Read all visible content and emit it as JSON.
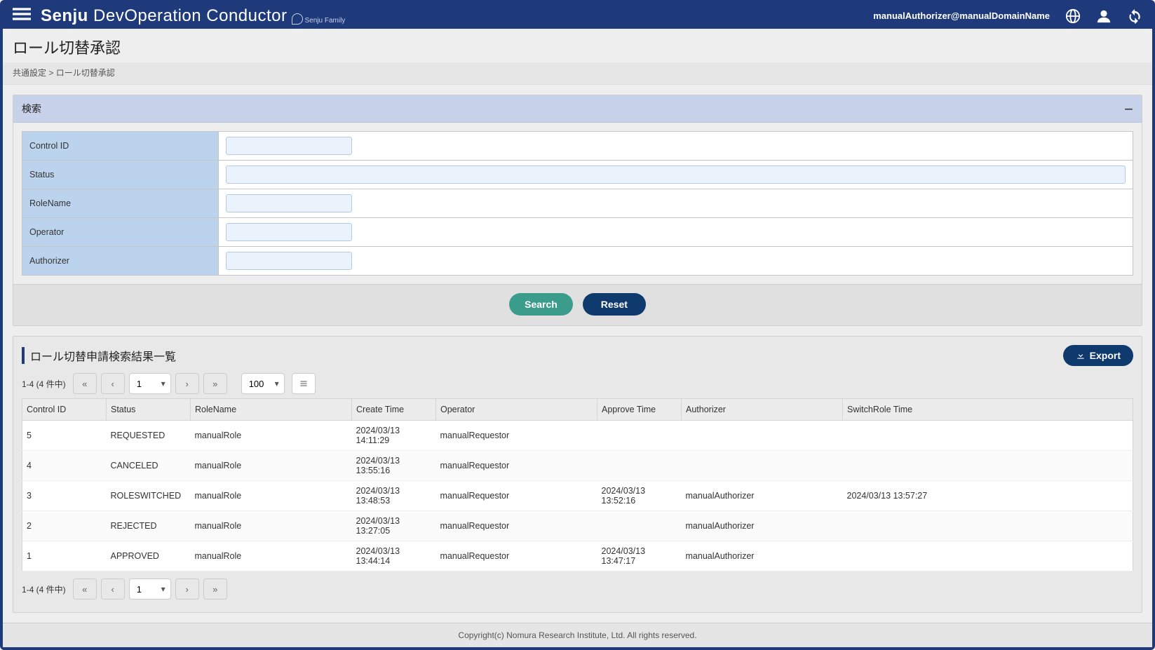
{
  "header": {
    "brand_bold": "Senju",
    "brand_rest": " DevOperation Conductor",
    "brand_family": "Senju Family",
    "username": "manualAuthorizer@manualDomainName"
  },
  "page": {
    "title": "ロール切替承認"
  },
  "breadcrumb": {
    "parent": "共通設定",
    "sep": " > ",
    "current": "ロール切替承認"
  },
  "search": {
    "panel_title": "検索",
    "fields": {
      "control_id": "Control ID",
      "status": "Status",
      "role_name": "RoleName",
      "operator": "Operator",
      "authorizer": "Authorizer"
    },
    "values": {
      "control_id": "",
      "status": "",
      "role_name": "",
      "operator": "",
      "authorizer": ""
    },
    "buttons": {
      "search": "Search",
      "reset": "Reset"
    }
  },
  "results": {
    "title": "ロール切替申請検索結果一覧",
    "export_label": "Export",
    "pager": {
      "info": "1-4 (4 件中)",
      "page": "1",
      "page_size": "100"
    },
    "columns": [
      "Control ID",
      "Status",
      "RoleName",
      "Create Time",
      "Operator",
      "Approve Time",
      "Authorizer",
      "SwitchRole Time"
    ],
    "rows": [
      {
        "control_id": "5",
        "status": "REQUESTED",
        "role_name": "manualRole",
        "create_time": "2024/03/13 14:11:29",
        "operator": "manualRequestor",
        "approve_time": "",
        "authorizer": "",
        "switch_time": ""
      },
      {
        "control_id": "4",
        "status": "CANCELED",
        "role_name": "manualRole",
        "create_time": "2024/03/13 13:55:16",
        "operator": "manualRequestor",
        "approve_time": "",
        "authorizer": "",
        "switch_time": ""
      },
      {
        "control_id": "3",
        "status": "ROLESWITCHED",
        "role_name": "manualRole",
        "create_time": "2024/03/13 13:48:53",
        "operator": "manualRequestor",
        "approve_time": "2024/03/13 13:52:16",
        "authorizer": "manualAuthorizer",
        "switch_time": "2024/03/13 13:57:27"
      },
      {
        "control_id": "2",
        "status": "REJECTED",
        "role_name": "manualRole",
        "create_time": "2024/03/13 13:27:05",
        "operator": "manualRequestor",
        "approve_time": "",
        "authorizer": "manualAuthorizer",
        "switch_time": ""
      },
      {
        "control_id": "1",
        "status": "APPROVED",
        "role_name": "manualRole",
        "create_time": "2024/03/13 13:44:14",
        "operator": "manualRequestor",
        "approve_time": "2024/03/13 13:47:17",
        "authorizer": "manualAuthorizer",
        "switch_time": ""
      }
    ]
  },
  "footer": {
    "copyright": "Copyright(c) Nomura Research Institute, Ltd. All rights reserved."
  }
}
